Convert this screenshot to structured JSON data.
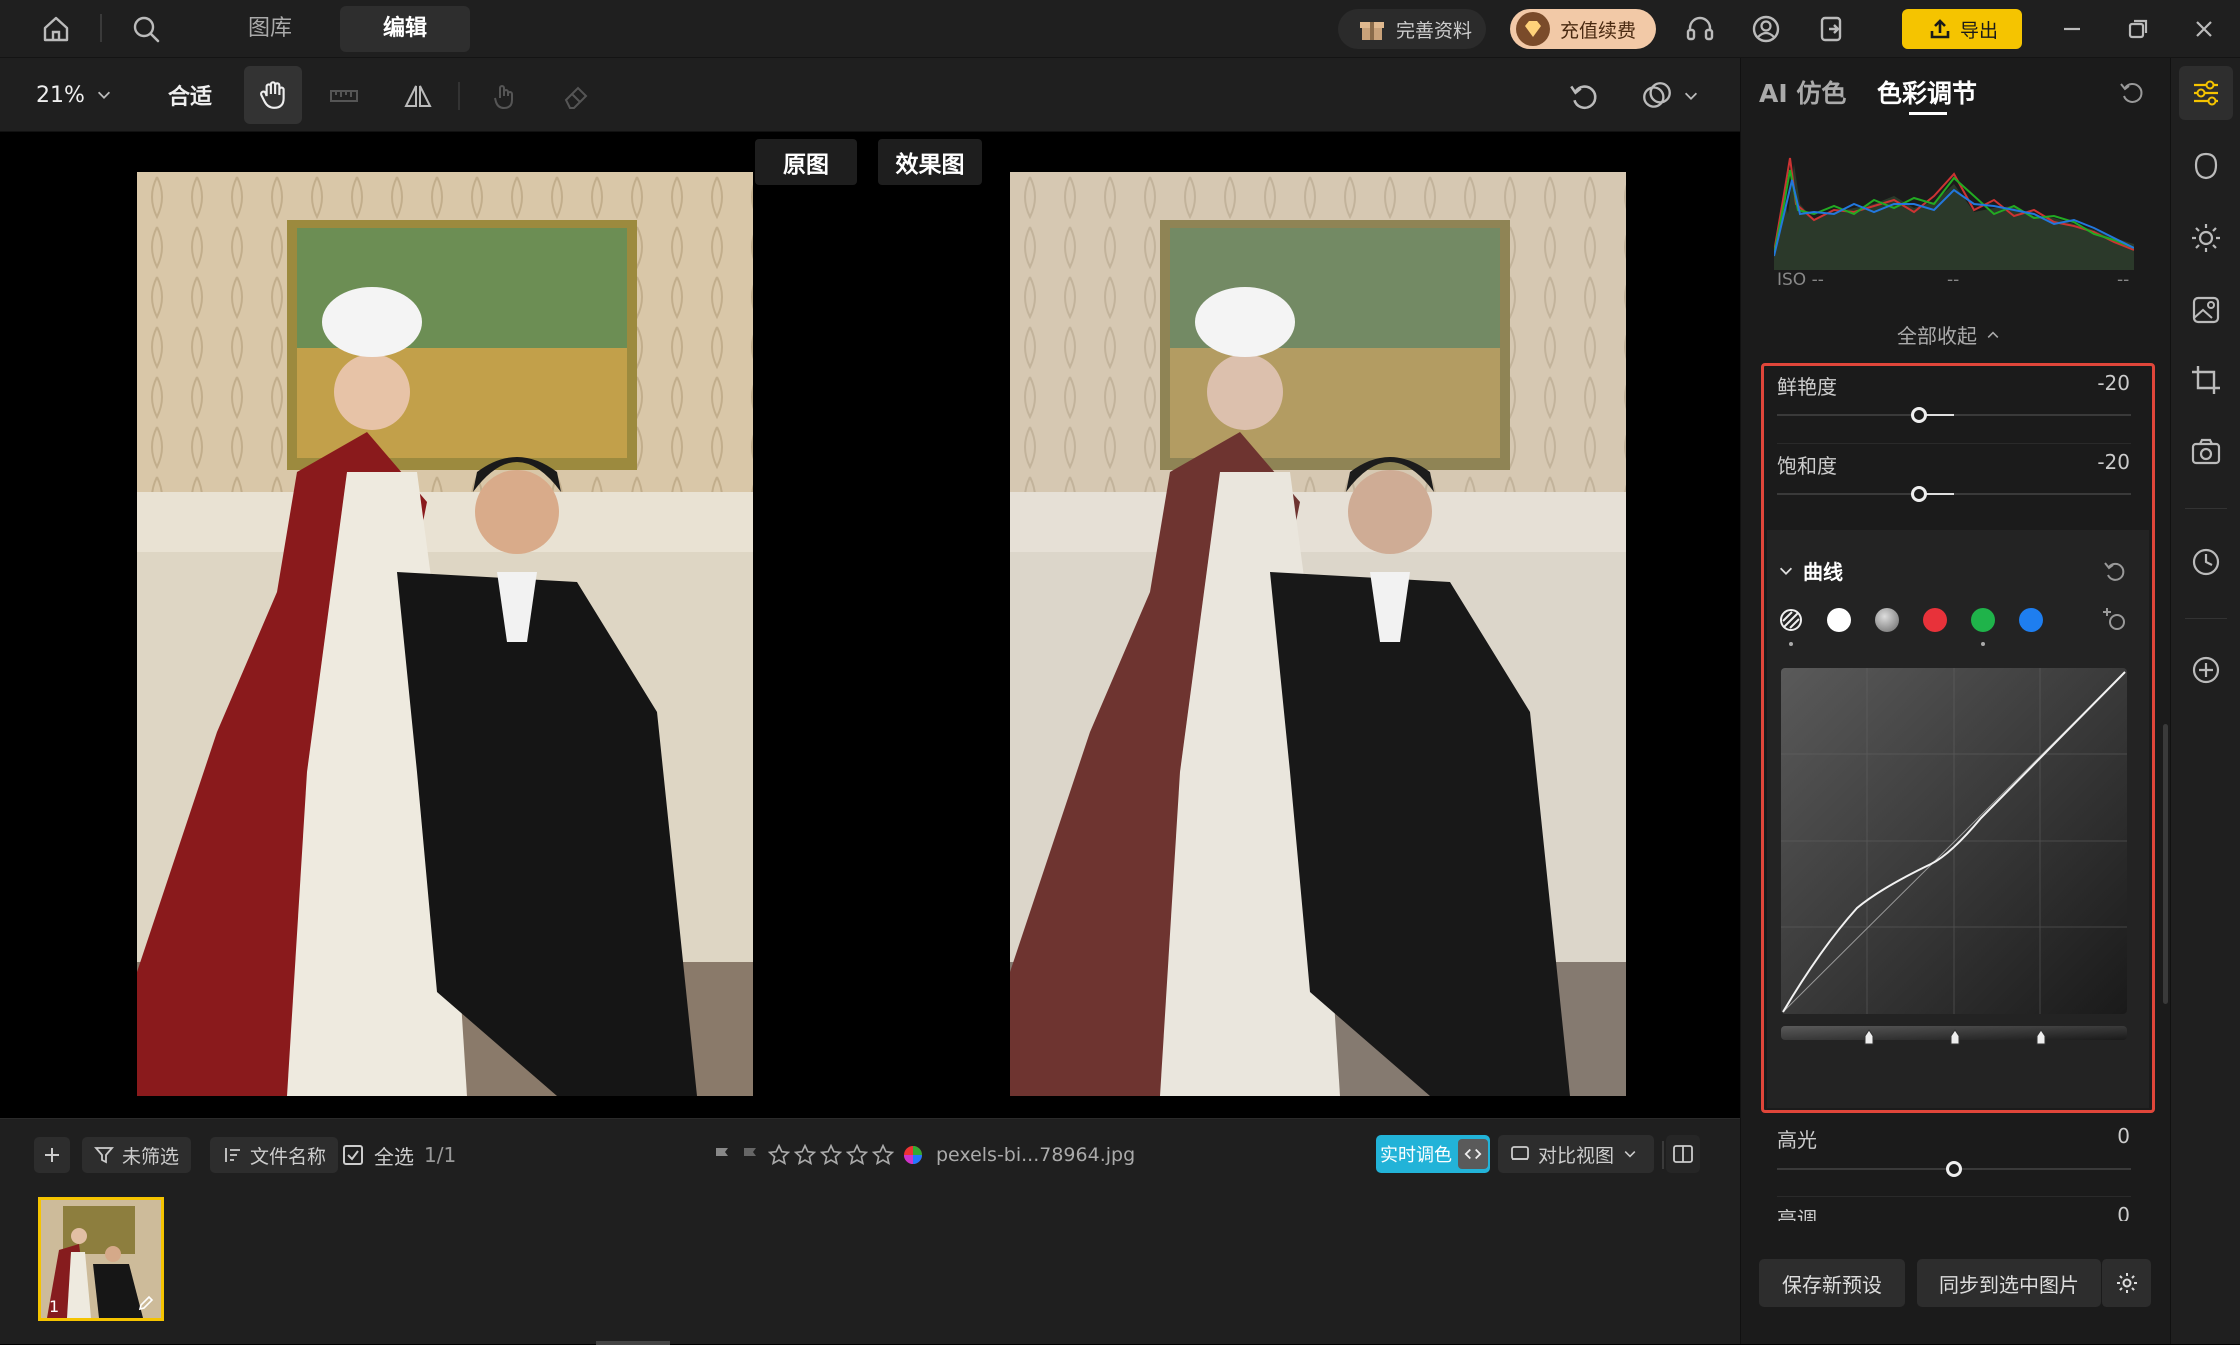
{
  "topbar": {
    "tab_library": "图库",
    "tab_edit": "编辑",
    "profile_label": "完善资料",
    "recharge_label": "充值续费",
    "export_label": "导出",
    "icons": [
      "home-icon",
      "search-icon",
      "gift-icon",
      "diamond-icon",
      "headset-icon",
      "user-icon",
      "logout-icon",
      "upload-icon",
      "minimize-icon",
      "restore-icon",
      "close-icon"
    ]
  },
  "toolbar": {
    "zoom": "21%",
    "fit_label": "合适"
  },
  "compare": {
    "original_label": "原图",
    "result_label": "效果图"
  },
  "bottombar": {
    "unfiltered_label": "未筛选",
    "filename_label": "文件名称",
    "select_all_label": "全选",
    "select_count": "1/1",
    "filename": "pexels-bi...78964.jpg",
    "realtime_label": "实时调色",
    "compare_view_label": "对比视图",
    "thumb_index": "1",
    "rating": 0
  },
  "panel": {
    "tab_ai": "AI 仿色",
    "tab_color": "色彩调节",
    "iso_label": "ISO --",
    "exif_mid": "--",
    "exif_right": "--",
    "collapse_all": "全部收起",
    "sliders": [
      {
        "label": "鲜艳度",
        "value": "-20",
        "level": -20
      },
      {
        "label": "饱和度",
        "value": "-20",
        "level": -20
      }
    ],
    "curve_title": "曲线",
    "curve_channels": [
      "luma",
      "white",
      "gray",
      "red",
      "green",
      "blue"
    ],
    "lower_sliders": [
      {
        "label": "高光",
        "value": "0",
        "level": 0
      },
      {
        "label": "亮调",
        "value": "0",
        "level": 0
      }
    ],
    "save_preset": "保存新预设",
    "sync_selected": "同步到选中图片"
  },
  "colors": {
    "accent_export": "#f5c400",
    "realtime_blue": "#22b3d8",
    "highlight_red": "#e0463a",
    "recharge": "#f2c9a7"
  }
}
